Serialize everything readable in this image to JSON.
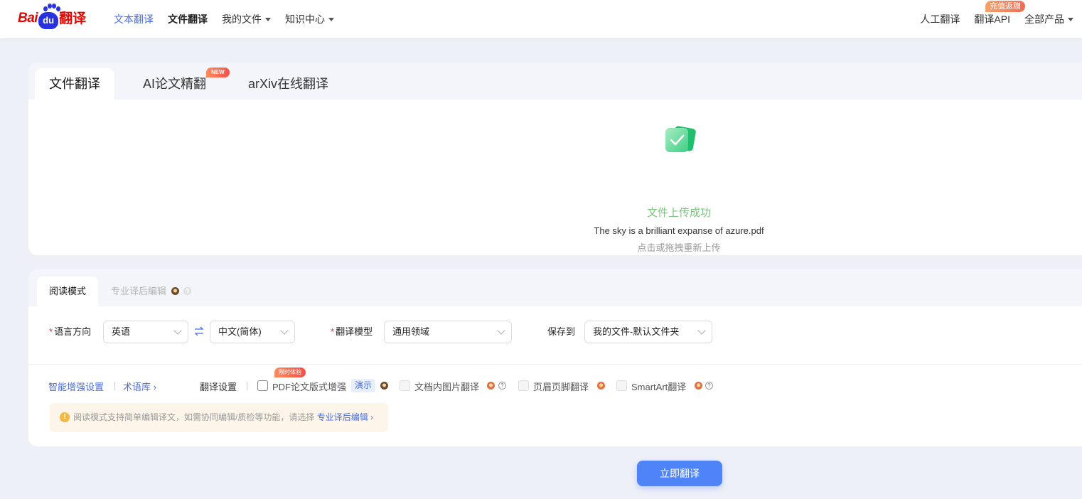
{
  "logo": {
    "text_bai": "Bai",
    "text_du": "du",
    "text_fanyi": "翻译"
  },
  "nav": {
    "left": [
      {
        "label": "文本翻译",
        "state": "active-link"
      },
      {
        "label": "文件翻译",
        "state": "current"
      },
      {
        "label": "我的文件",
        "dropdown": true
      },
      {
        "label": "知识中心",
        "dropdown": true
      }
    ],
    "right": [
      {
        "label": "人工翻译"
      },
      {
        "label": "翻译API",
        "badge": "充值返赠"
      },
      {
        "label": "全部产品",
        "dropdown": true
      }
    ]
  },
  "upload_card": {
    "tabs": [
      {
        "label": "文件翻译",
        "active": true
      },
      {
        "label": "AI论文精翻",
        "badge": "NEW"
      },
      {
        "label": "arXiv在线翻译"
      }
    ],
    "status_title": "文件上传成功",
    "file_name": "The sky is a brilliant expanse of azure.pdf",
    "reupload_hint": "点击或拖拽重新上传"
  },
  "settings_card": {
    "tabs": [
      {
        "label": "阅读模式",
        "active": true
      },
      {
        "label": "专业译后编辑",
        "active": false
      }
    ],
    "language_direction": {
      "label": "语言方向",
      "source": "英语",
      "target": "中文(简体)"
    },
    "model": {
      "label": "翻译模型",
      "value": "通用领域"
    },
    "save_to": {
      "label": "保存到",
      "value": "我的文件-默认文件夹"
    },
    "links": {
      "smart": "智能增强设置",
      "glossary": "术语库"
    },
    "translate_settings_label": "翻译设置",
    "options": [
      {
        "label": "PDF论文版式增强",
        "checked": false,
        "enabled": true,
        "demo_tag": "演示",
        "badge": "限时体验"
      },
      {
        "label": "文档内图片翻译",
        "checked": false,
        "enabled": false
      },
      {
        "label": "页眉页脚翻译",
        "checked": false,
        "enabled": false
      },
      {
        "label": "SmartArt翻译",
        "checked": false,
        "enabled": false
      }
    ],
    "notice": {
      "text": "阅读模式支持简单编辑译文，如需协同编辑/质检等功能，请选择",
      "link": "专业译后编辑"
    }
  },
  "translate_button": "立即翻译",
  "colors": {
    "accent": "#4e84f7",
    "success": "#7bc47f",
    "brand_red": "#e10602",
    "brand_blue": "#2932e1"
  }
}
